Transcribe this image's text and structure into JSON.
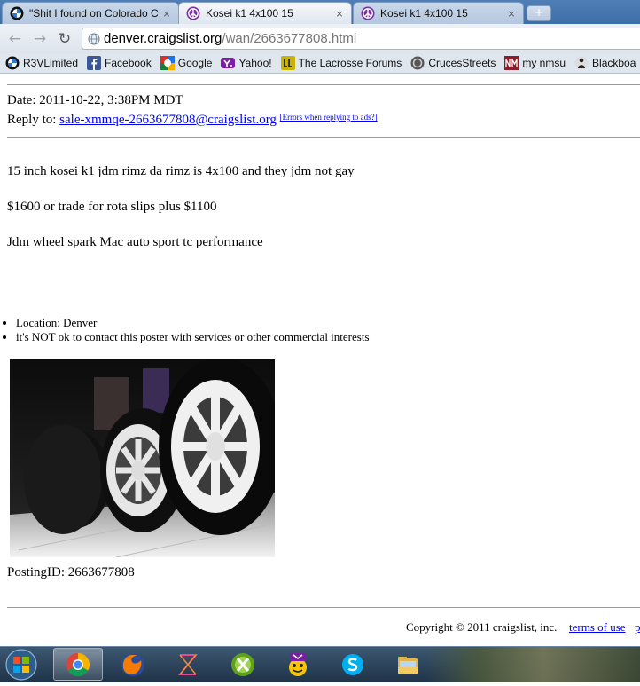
{
  "tabs": [
    {
      "title": "\"Shit I found on Colorado C",
      "favicon": "bmw-logo-icon",
      "active": false
    },
    {
      "title": "Kosei k1 4x100 15",
      "favicon": "craigslist-peace-icon",
      "active": true
    },
    {
      "title": "Kosei k1 4x100 15",
      "favicon": "craigslist-peace-icon",
      "active": false
    }
  ],
  "tab_close_glyph": "×",
  "new_tab_glyph": "+",
  "toolbar": {
    "back_glyph": "←",
    "forward_glyph": "→",
    "reload_glyph": "↻",
    "url_host": "denver.craigslist.org",
    "url_path": "/wan/2663677808.html"
  },
  "bookmarks": [
    {
      "label": "R3VLimited",
      "icon": "bmw-logo-icon"
    },
    {
      "label": "Facebook",
      "icon": "facebook-icon"
    },
    {
      "label": "Google",
      "icon": "google-icon"
    },
    {
      "label": "Yahoo!",
      "icon": "yahoo-icon"
    },
    {
      "label": "The Lacrosse Forums",
      "icon": "lacrosse-forums-icon"
    },
    {
      "label": "CrucesStreets",
      "icon": "crucesstreets-icon"
    },
    {
      "label": "my nmsu",
      "icon": "nmsu-icon"
    },
    {
      "label": "Blackboa",
      "icon": "blackboard-icon"
    }
  ],
  "posting": {
    "date_line": "Date: 2011-10-22, 3:38PM MDT",
    "reply_label": "Reply to:",
    "reply_email": "sale-xmmqe-2663677808@craigslist.org",
    "errors_link": "[Errors when replying to ads?]",
    "body": [
      "15 inch kosei k1 jdm rimz da rimz is 4x100 and they jdm not gay",
      "$1600 or trade for rota slips plus $1100",
      "Jdm wheel spark Mac auto sport tc performance"
    ],
    "attributes": [
      "Location: Denver",
      "it's NOT ok to contact this poster with services or other commercial interests"
    ],
    "posting_id": "PostingID: 2663677808"
  },
  "footer": {
    "copyright": "Copyright © 2011 craigslist, inc.",
    "terms_link": "terms of use",
    "partial_link": "p"
  },
  "taskbar": {
    "items": [
      "windows-start-icon",
      "chrome-icon",
      "firefox-icon",
      "zune-icon",
      "xbox-icon",
      "yahoo-messenger-icon",
      "skype-icon",
      "windows-explorer-icon"
    ]
  },
  "colors": {
    "link": "#0000ee",
    "tabstrip": "#4a7ab2",
    "taskbar": "#2a4158"
  }
}
